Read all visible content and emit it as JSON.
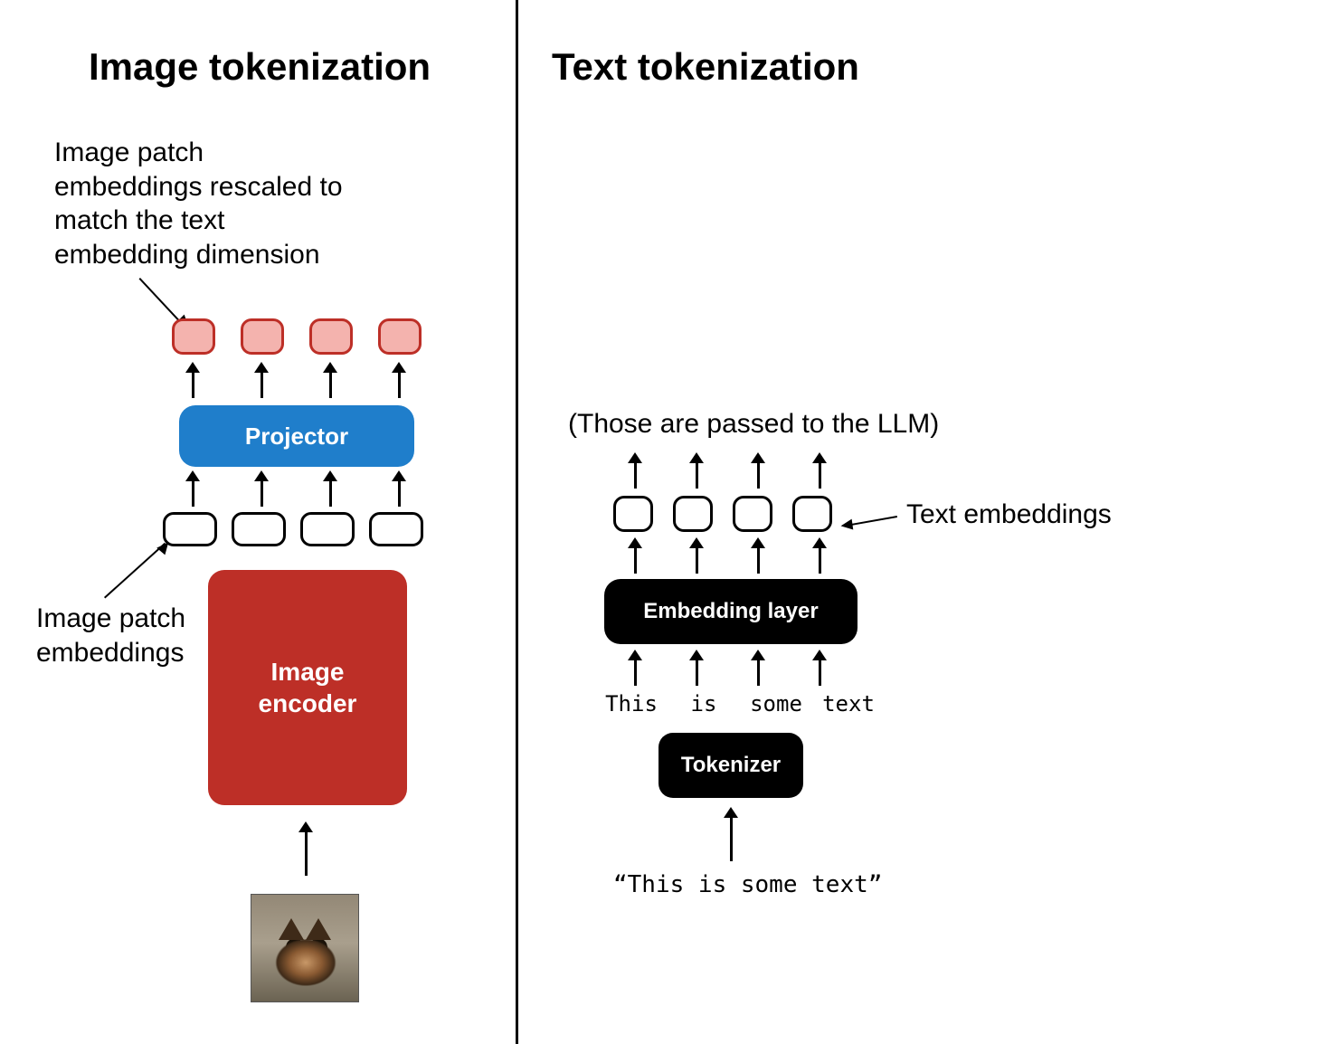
{
  "left": {
    "title": "Image tokenization",
    "annotation_top": "Image patch\nembeddings rescaled to\nmatch the text\nembedding dimension",
    "annotation_mid": "Image patch\nembeddings",
    "projector_label": "Projector",
    "encoder_label": "Image\nencoder"
  },
  "right": {
    "title": "Text tokenization",
    "llm_note": "(Those are passed to the LLM)",
    "text_embeddings_label": "Text embeddings",
    "embedding_layer_label": "Embedding layer",
    "tokens": [
      "This",
      "is",
      "some",
      "text"
    ],
    "tokenizer_label": "Tokenizer",
    "input_text": "“This is some text”"
  },
  "colors": {
    "projector": "#1f7ecb",
    "encoder": "#bd2f27",
    "token_red_fill": "#f4b3ae"
  }
}
